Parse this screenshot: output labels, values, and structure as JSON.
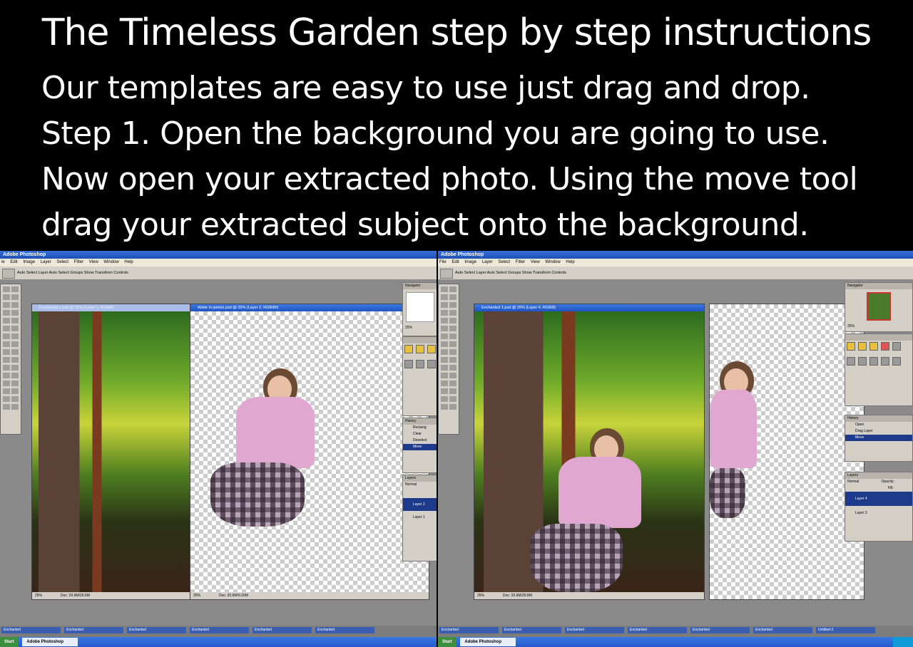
{
  "heading": "The Timeless Garden step by step instructions",
  "instructions": [
    "Our templates are easy to use just drag and drop.",
    "Step 1. Open the background you are going to use.",
    "Now open your extracted photo.  Using the move tool",
    "drag your extracted subject onto the background."
  ],
  "screens": {
    "left": {
      "app_title": "Adobe Photoshop",
      "menu": [
        "le",
        "Edit",
        "Image",
        "Layer",
        "Select",
        "Filter",
        "View",
        "Window",
        "Help"
      ],
      "options": "Auto Select Layer   Auto Select Groups   Show Transform Controls",
      "doc1_title": "Enchanted 1.psd @ 25% (Layer 3, RGB/8)",
      "doc1_zoom": "25%",
      "doc1_size": "Doc: 20.6M/20.6M",
      "doc2_title": "Abbie in jamies.psd @ 25% (Layer 2, RGB/8#)",
      "doc2_zoom": "25%",
      "doc2_size": "Doc: 20.6M/9.20M",
      "navigator_tab": "Navigator",
      "zoom_field": "25%",
      "history_tab": "History",
      "history": [
        "Rectang",
        "Clear",
        "Deselect",
        "Move"
      ],
      "layers_tab": "Layers",
      "blend_mode": "Normal",
      "layers": [
        "Layer 2",
        "Layer 1"
      ],
      "taskbar": {
        "mini": [
          "Enchanted",
          "Enchanted",
          "Enchanted",
          "Enchanted",
          "Enchanted",
          "Enchanted"
        ],
        "start": "Start",
        "app": "Adobe Photoshop"
      }
    },
    "right": {
      "app_title": "Adobe Photoshop",
      "menu": [
        "File",
        "Edit",
        "Image",
        "Layer",
        "Select",
        "Filter",
        "View",
        "Window",
        "Help"
      ],
      "options": "Auto Select Layer   Auto Select Groups   Show Transform Controls",
      "doc1_title": "Enchanted 1.psd @ 25% (Layer 4, RGB/8)",
      "doc1_zoom": "25%",
      "doc1_size": "Doc: 20.6M/29.8M",
      "navigator_tab": "Navigator",
      "zoom_field": "25%",
      "history_tab": "History",
      "history": [
        "Open",
        "Drag Layer",
        "Move"
      ],
      "layers_tab": "Layers",
      "blend_mode": "Normal",
      "opacity_label": "Opacity:",
      "fill_label": "Fill:",
      "layers": [
        "Layer 4",
        "Layer 3"
      ],
      "taskbar": {
        "mini": [
          "Enchanted",
          "Enchanted",
          "Enchanted",
          "Enchanted",
          "Enchanted",
          "Enchanted",
          "Untitled-2"
        ],
        "start": "Start",
        "app": "Adobe Photoshop"
      }
    }
  }
}
